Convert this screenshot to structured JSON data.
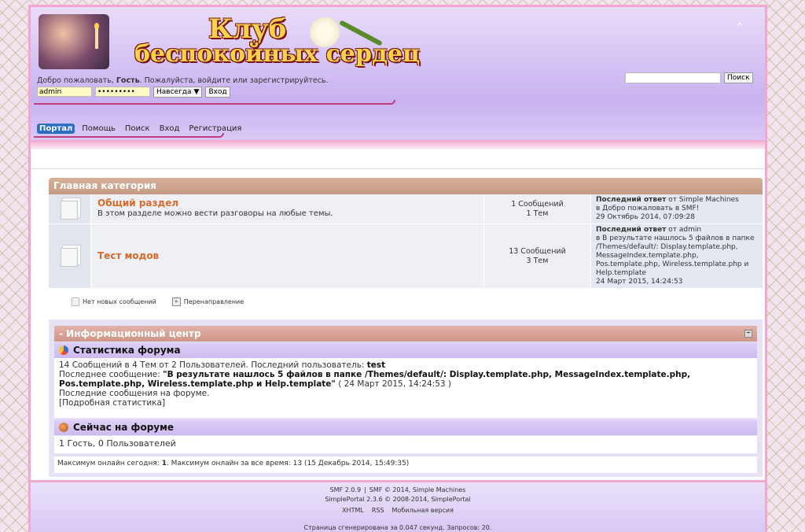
{
  "header": {
    "logo_line1": "Клуб",
    "logo_line2": "беспокойных сердец",
    "collapse_glyph": "⌃",
    "welcome_prefix": "Добро пожаловать,",
    "welcome_user": "Гость",
    "welcome_suffix": ". Пожалуйста, войдите или зарегистрируйтесь.",
    "login": {
      "username_value": "admin",
      "password_value": "•••••••••",
      "duration_value": "Навсегда",
      "submit_label": "Вход"
    },
    "search": {
      "input_value": "",
      "button_label": "Поиск"
    }
  },
  "menu": {
    "items": [
      "Портал",
      "Помощь",
      "Поиск",
      "Вход",
      "Регистрация"
    ]
  },
  "category": {
    "title": "Главная категория",
    "boards": [
      {
        "title": "Общий раздел",
        "description": "В этом разделе можно вести разговоры на любые темы.",
        "posts": "1 Сообщений",
        "topics": "1 Тем",
        "last_label": "Последний ответ",
        "last_by": "от Simple Machines",
        "last_topic": "в Добро пожаловать в SMF!",
        "last_date": "29 Октябрь 2014, 07:09:28"
      },
      {
        "title": "Тест модов",
        "description": "",
        "posts": "13 Сообщений",
        "topics": "3 Тем",
        "last_label": "Последний ответ",
        "last_by": "от admin",
        "last_topic": "в В результате нашлось 5 файлов в папке /Themes/default/: Display.template.php, MessageIndex.template.php, Pos.template.php, Wireless.template.php и Help.template",
        "last_date": "24 Март 2015, 14:24:53"
      }
    ]
  },
  "legend": {
    "no_new": "Нет новых сообщений",
    "redirect": "Перенаправление"
  },
  "info_center": {
    "title": "- Информационный центр",
    "stats_title": "Статистика форума",
    "stats_line1_prefix": "14 Сообщений в 4 Тем от 2 Пользователей. Последний пользователь:",
    "stats_latest_member": "test",
    "stats_line2_prefix": "Последнее сообщение:",
    "stats_latest_post": "\"В результате нашлось 5 файлов в папке /Themes/default/: Display.template.php, MessageIndex.template.php, Pos.template.php, Wireless.template.php и Help.template\"",
    "stats_latest_date": "( 24 Март 2015, 14:24:53 )",
    "stats_recent": "Последние сообщения на форуме.",
    "stats_detailed": "[Подробная статистика]",
    "online_title": "Сейчас на форуме",
    "online_text": "1 Гость, 0 Пользователей",
    "max_online_prefix": "Максимум онлайн сегодня:",
    "max_online_today": "1",
    "max_online_suffix": ". Максимум онлайн за все время: 13 (15 Декабрь 2014, 15:49:35)"
  },
  "footer": {
    "smf": "SMF 2.0.9",
    "sep": "|",
    "smf_copy": "SMF © 2014, Simple Machines",
    "portal": "SimplePortal 2.3.6 © 2008-2014, SimplePortal",
    "links": [
      "XHTML",
      "RSS",
      "Мобильная версия"
    ],
    "generated": "Страница сгенерирована за 0.047 секунд. Запросов: 20."
  }
}
